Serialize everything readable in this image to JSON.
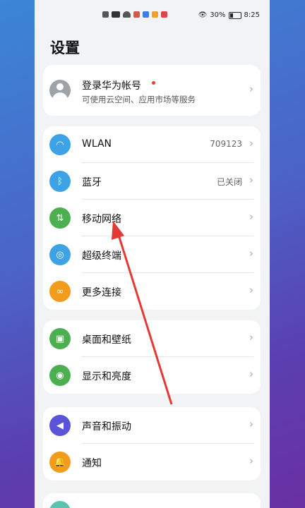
{
  "status_bar": {
    "battery_percent": "30%",
    "time": "8:25",
    "battery_level": 0.3
  },
  "page": {
    "title": "设置"
  },
  "account": {
    "title": "登录华为帐号",
    "subtitle": "可使用云空间、应用市场等服务"
  },
  "groups": [
    {
      "items": [
        {
          "label": "WLAN",
          "value": "709123",
          "icon": "wifi-icon",
          "color": "#3ea3e6"
        },
        {
          "label": "蓝牙",
          "value": "已关闭",
          "icon": "bluetooth-icon",
          "color": "#3ea3e6"
        },
        {
          "label": "移动网络",
          "value": "",
          "icon": "mobile-data-icon",
          "color": "#4caf50"
        },
        {
          "label": "超级终端",
          "value": "",
          "icon": "super-device-icon",
          "color": "#3ea3e6"
        },
        {
          "label": "更多连接",
          "value": "",
          "icon": "link-icon",
          "color": "#f39b1b"
        }
      ]
    },
    {
      "items": [
        {
          "label": "桌面和壁纸",
          "value": "",
          "icon": "wallpaper-icon",
          "color": "#4caf50"
        },
        {
          "label": "显示和亮度",
          "value": "",
          "icon": "eye-icon",
          "color": "#4caf50"
        }
      ]
    },
    {
      "items": [
        {
          "label": "声音和振动",
          "value": "",
          "icon": "sound-icon",
          "color": "#5a53d8"
        },
        {
          "label": "通知",
          "value": "",
          "icon": "bell-icon",
          "color": "#f39b1b"
        }
      ]
    }
  ],
  "annotation": {
    "color": "#e53935"
  }
}
